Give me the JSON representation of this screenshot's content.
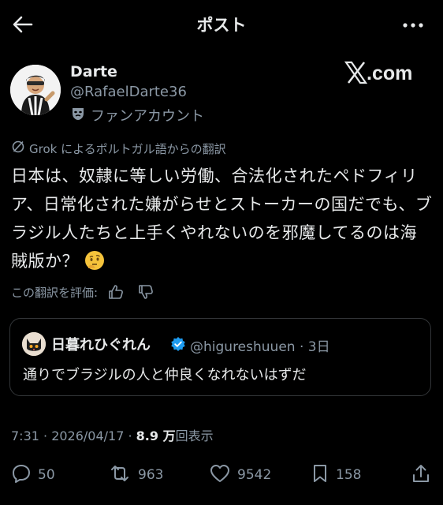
{
  "header": {
    "title": "ポスト"
  },
  "author": {
    "display_name": "Darte",
    "handle": "@RafaelDarte36",
    "fan_label": "ファンアカウント"
  },
  "watermark": {
    "text": "𝕏.com"
  },
  "translation": {
    "note": "Grok によるポルトガル語からの翻訳",
    "rate_label": "この翻訳を評価:"
  },
  "tweet": {
    "text": "日本は、奴隷に等しい労働、合法化されたペドフィリア、日常化された嫌がらせとストーカーの国だでも、ブラジル人たちと上手くやれないのを邪魔してるのは海賊版か？"
  },
  "quote": {
    "display_name": "日暮れひぐれん",
    "meta": "@higureshuuen · 3日",
    "text": "通りでブラジルの人と仲良くなれないはずだ"
  },
  "stamp": {
    "time_date": "7:31 · 2026/04/17 · ",
    "views_count": "8.9 万",
    "views_label": "回表示"
  },
  "actions": {
    "replies": "50",
    "reposts": "963",
    "likes": "9542",
    "bookmarks": "158"
  },
  "colors": {
    "background": "#000000",
    "primary_text": "#e7e9ea",
    "secondary_text": "#8b98a5",
    "verified": "#1d9bf0",
    "border": "#333639"
  }
}
